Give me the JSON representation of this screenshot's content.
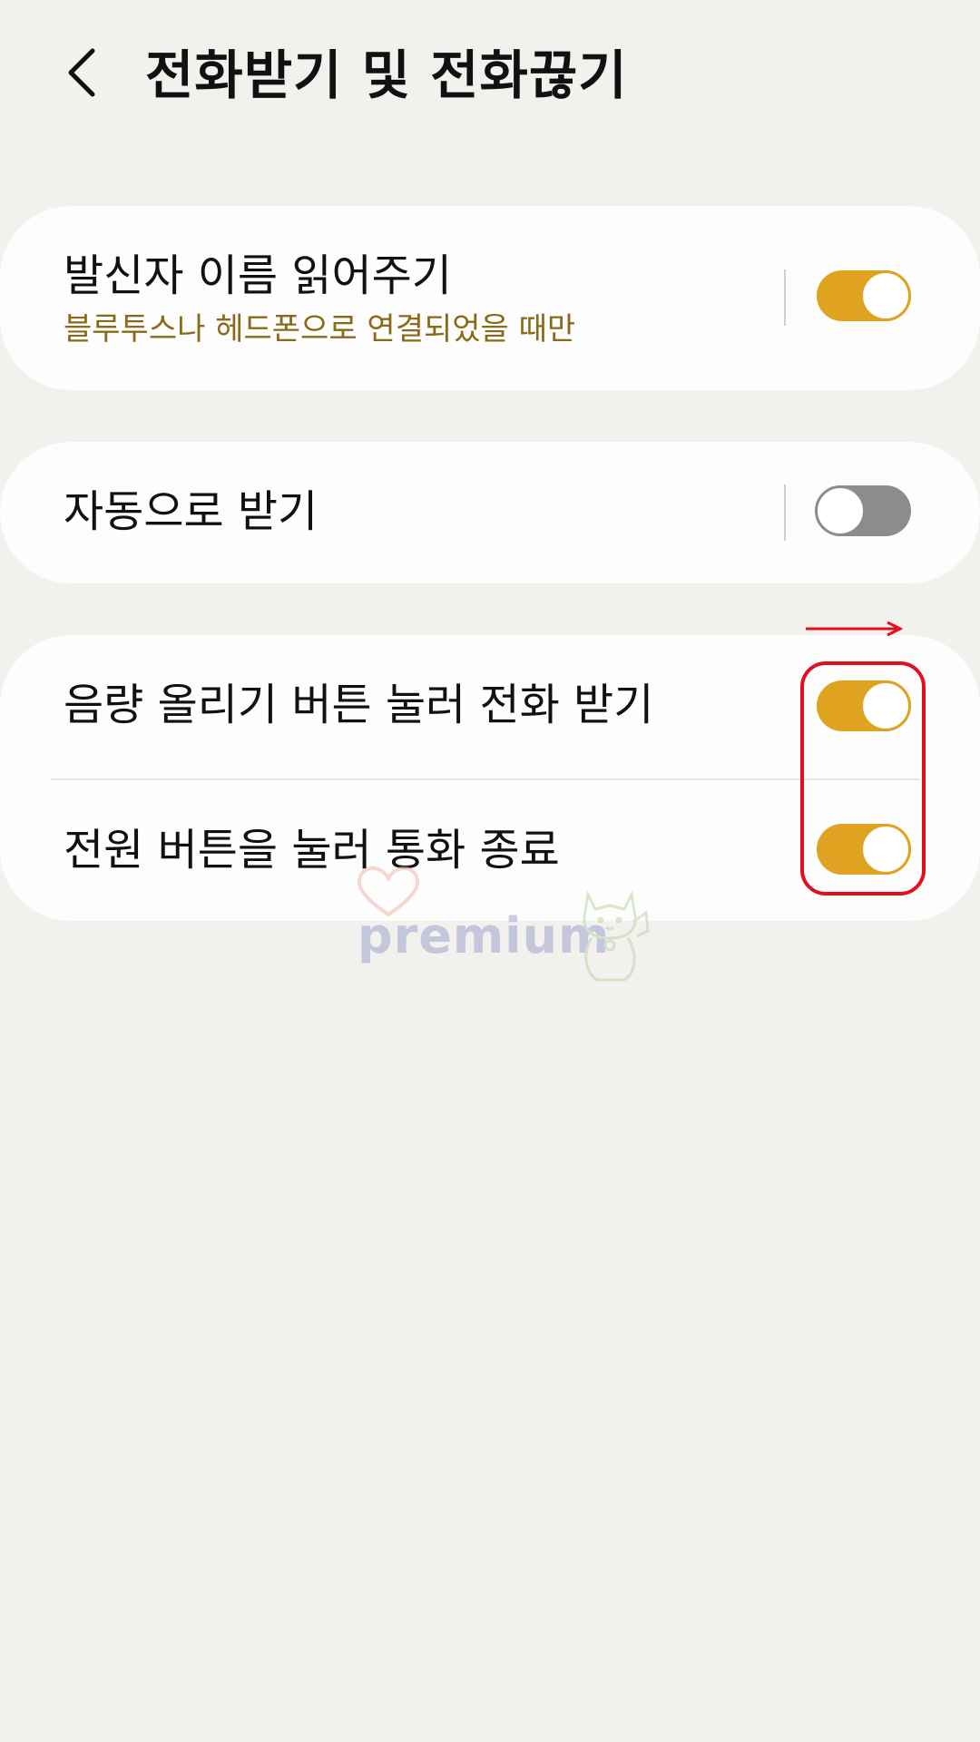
{
  "header": {
    "back_icon": "chevron-left-icon",
    "title": "전화받기 및 전화끊기"
  },
  "colors": {
    "background": "#f2f1ee",
    "card": "#fdfdfd",
    "toggle_on": "#e0a221",
    "toggle_off": "#8c8c8c",
    "subtitle": "#8a6a17",
    "annotation": "#e0101f"
  },
  "settings": [
    {
      "title": "발신자 이름 읽어주기",
      "subtitle": "블루투스나 헤드폰으로 연결되었을 때만",
      "enabled": true
    },
    {
      "title": "자동으로 받기",
      "enabled": false
    },
    {
      "title": "음량 올리기 버튼 눌러 전화 받기",
      "enabled": true
    },
    {
      "title": "전원 버튼을 눌러 통화 종료",
      "enabled": true
    }
  ],
  "watermark": {
    "text": "premium"
  }
}
